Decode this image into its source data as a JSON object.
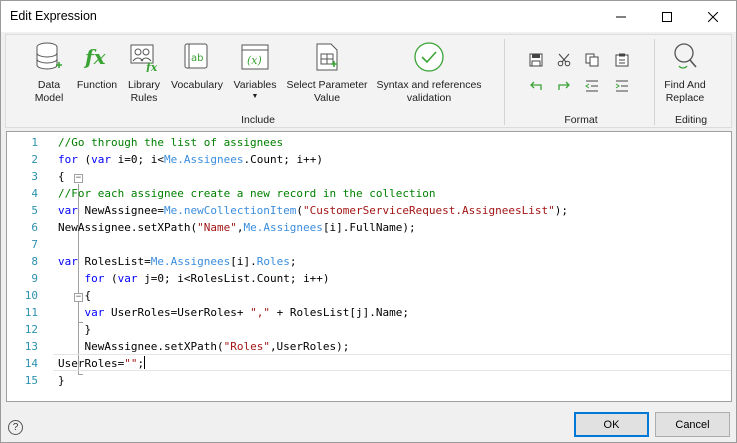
{
  "window": {
    "title": "Edit Expression"
  },
  "ribbon": {
    "include_buttons": [
      {
        "label": "Data\nModel",
        "icon": "database-add-icon"
      },
      {
        "label": "Function",
        "icon": "function-fx-icon"
      },
      {
        "label": "Library\nRules",
        "icon": "library-rules-icon"
      },
      {
        "label": "Vocabulary",
        "icon": "vocabulary-ab-icon"
      },
      {
        "label": "Variables",
        "icon": "variables-x-icon"
      },
      {
        "label": "Select Parameter\nValue",
        "icon": "select-parameter-icon"
      },
      {
        "label": "Syntax and references\nvalidation",
        "icon": "validation-check-icon"
      }
    ],
    "include_label": "Include",
    "format_label": "Format",
    "format_buttons": [
      "save-icon",
      "cut-icon",
      "copy-icon",
      "paste-icon",
      "undo-icon",
      "redo-icon",
      "outdent-icon",
      "indent-icon"
    ],
    "find_label": "Find And\nReplace",
    "editing_label": "Editing"
  },
  "editor": {
    "line_numbers": [
      "1",
      "2",
      "3",
      "4",
      "5",
      "6",
      "7",
      "8",
      "9",
      "10",
      "11",
      "12",
      "13",
      "14",
      "15"
    ],
    "lines": [
      [
        {
          "t": "cm",
          "v": "//Go through the list of assignees"
        }
      ],
      [
        {
          "t": "kw",
          "v": "for"
        },
        {
          "t": "",
          "v": " ("
        },
        {
          "t": "kw",
          "v": "var"
        },
        {
          "t": "",
          "v": " i=0; i<"
        },
        {
          "t": "obj",
          "v": "Me.Assignees"
        },
        {
          "t": "",
          "v": ".Count; i++)"
        }
      ],
      [
        {
          "t": "",
          "v": "{"
        }
      ],
      [
        {
          "t": "cm",
          "v": "//For each assignee create a new record in the collection"
        }
      ],
      [
        {
          "t": "kw",
          "v": "var"
        },
        {
          "t": "",
          "v": " NewAssignee="
        },
        {
          "t": "obj",
          "v": "Me.newCollectionItem"
        },
        {
          "t": "",
          "v": "("
        },
        {
          "t": "str",
          "v": "\"CustomerServiceRequest.AssigneesList\""
        },
        {
          "t": "",
          "v": ");"
        }
      ],
      [
        {
          "t": "",
          "v": "NewAssignee.setXPath("
        },
        {
          "t": "str",
          "v": "\"Name\""
        },
        {
          "t": "",
          "v": ","
        },
        {
          "t": "obj",
          "v": "Me.Assignees"
        },
        {
          "t": "",
          "v": "[i].FullName);"
        }
      ],
      [],
      [
        {
          "t": "kw",
          "v": "var"
        },
        {
          "t": "",
          "v": " RolesList="
        },
        {
          "t": "obj",
          "v": "Me.Assignees"
        },
        {
          "t": "",
          "v": "[i]."
        },
        {
          "t": "obj",
          "v": "Roles"
        },
        {
          "t": "",
          "v": ";"
        }
      ],
      [
        {
          "t": "",
          "v": "    "
        },
        {
          "t": "kw",
          "v": "for"
        },
        {
          "t": "",
          "v": " ("
        },
        {
          "t": "kw",
          "v": "var"
        },
        {
          "t": "",
          "v": " j=0; i<RolesList.Count; i++)"
        }
      ],
      [
        {
          "t": "",
          "v": "    {"
        }
      ],
      [
        {
          "t": "",
          "v": "    "
        },
        {
          "t": "kw",
          "v": "var"
        },
        {
          "t": "",
          "v": " UserRoles=UserRoles+ "
        },
        {
          "t": "str",
          "v": "\",\""
        },
        {
          "t": "",
          "v": " + RolesList[j].Name;"
        }
      ],
      [
        {
          "t": "",
          "v": "    }"
        }
      ],
      [
        {
          "t": "",
          "v": "    NewAssignee.setXPath("
        },
        {
          "t": "str",
          "v": "\"Roles\""
        },
        {
          "t": "",
          "v": ",UserRoles);"
        }
      ],
      [
        {
          "t": "",
          "v": "UserRoles="
        },
        {
          "t": "str",
          "v": "\"\""
        },
        {
          "t": "",
          "v": ";"
        }
      ],
      [
        {
          "t": "",
          "v": "}"
        }
      ]
    ]
  },
  "footer": {
    "ok_label": "OK",
    "cancel_label": "Cancel",
    "help_label": "?"
  }
}
